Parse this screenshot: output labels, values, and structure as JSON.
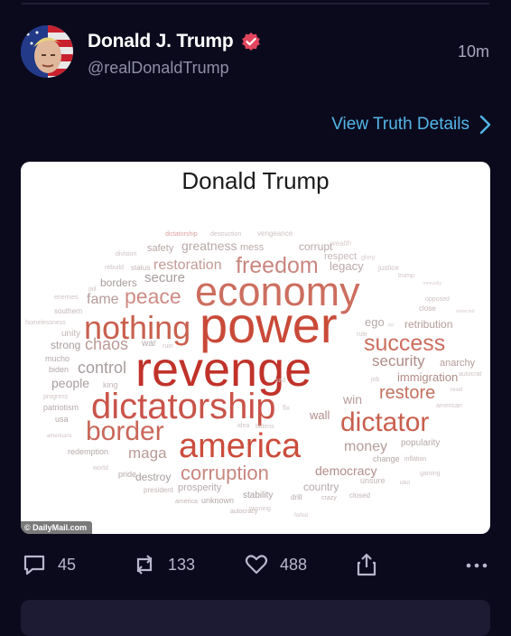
{
  "post": {
    "display_name": "Donald J. Trump",
    "handle": "@realDonaldTrump",
    "time": "10m",
    "view_details": "View Truth Details"
  },
  "image": {
    "title": "Donald Trump",
    "credit": "© DailyMail.com",
    "words": [
      {
        "t": "dictatorship",
        "c": "#d9a3a0"
      },
      {
        "t": "destruction",
        "c": "#cfc3c3"
      },
      {
        "t": "vengeance",
        "c": "#cfc3c3"
      },
      {
        "t": "division",
        "c": "#cfc3c3"
      },
      {
        "t": "safety",
        "c": "#b9a7a7"
      },
      {
        "t": "greatness",
        "c": "#b9a7a7"
      },
      {
        "t": "mess",
        "c": "#bcaaaa"
      },
      {
        "t": "corrupt",
        "c": "#b9a7a7"
      },
      {
        "t": "wealth",
        "c": "#d9cccc"
      },
      {
        "t": "respect",
        "c": "#c8b8b8"
      },
      {
        "t": "glory",
        "c": "#d9cccc"
      },
      {
        "t": "rebuild",
        "c": "#cfc3c3"
      },
      {
        "t": "status",
        "c": "#c4b4b4"
      },
      {
        "t": "restoration",
        "c": "#c49a96"
      },
      {
        "t": "freedom",
        "c": "#c9867f"
      },
      {
        "t": "legacy",
        "c": "#b9a7a7"
      },
      {
        "t": "justice",
        "c": "#cfc3c3"
      },
      {
        "t": "jail",
        "c": "#d0c3c3"
      },
      {
        "t": "borders",
        "c": "#a89d9d"
      },
      {
        "t": "secure",
        "c": "#a89d9d"
      },
      {
        "t": "trump",
        "c": "#d0c3c3"
      },
      {
        "t": "immunity",
        "c": "#d9cccc"
      },
      {
        "t": "enemies",
        "c": "#d0c3c3"
      },
      {
        "t": "fame",
        "c": "#b49c9a"
      },
      {
        "t": "peace",
        "c": "#cf8b84"
      },
      {
        "t": "economy",
        "c": "#cc6e5f"
      },
      {
        "t": "opposed",
        "c": "#d0c3c3"
      },
      {
        "t": "southern",
        "c": "#c4b4b4"
      },
      {
        "t": "close",
        "c": "#c4b4b4"
      },
      {
        "t": "reelected",
        "c": "#d9cccc"
      },
      {
        "t": "homelessness",
        "c": "#d0c3c3"
      },
      {
        "t": "nothing",
        "c": "#c95f4d"
      },
      {
        "t": "power",
        "c": "#c94a38"
      },
      {
        "t": "ego",
        "c": "#b5a9a9"
      },
      {
        "t": "tax",
        "c": "#d9cccc"
      },
      {
        "t": "retribution",
        "c": "#b49c9a"
      },
      {
        "t": "unity",
        "c": "#c4b4b4"
      },
      {
        "t": "rule",
        "c": "#d0c3c3"
      },
      {
        "t": "strong",
        "c": "#a89d9d"
      },
      {
        "t": "war",
        "c": "#b5a9a9"
      },
      {
        "t": "ruin",
        "c": "#d0c3c3"
      },
      {
        "t": "chaos",
        "c": "#b89a96"
      },
      {
        "t": "success",
        "c": "#cc6e5f"
      },
      {
        "t": "mucho",
        "c": "#b5a9a9"
      },
      {
        "t": "revenge",
        "c": "#c0322a"
      },
      {
        "t": "security",
        "c": "#b08c88"
      },
      {
        "t": "anarchy",
        "c": "#b49c9a"
      },
      {
        "t": "biden",
        "c": "#b5a9a9"
      },
      {
        "t": "control",
        "c": "#a89d9d"
      },
      {
        "t": "immigration",
        "c": "#b08c88"
      },
      {
        "t": "job",
        "c": "#d0c3c3"
      },
      {
        "t": "sad",
        "c": "#d0c3c3"
      },
      {
        "t": "autocrat",
        "c": "#d0c3c3"
      },
      {
        "t": "people",
        "c": "#a89d9d"
      },
      {
        "t": "king",
        "c": "#c4b4b4"
      },
      {
        "t": "restore",
        "c": "#c4705f"
      },
      {
        "t": "reset",
        "c": "#d0c3c3"
      },
      {
        "t": "progress",
        "c": "#d0c3c3"
      },
      {
        "t": "dictatorship",
        "c": "#c9544a"
      },
      {
        "t": "win",
        "c": "#b49c9a"
      },
      {
        "t": "patriotism",
        "c": "#b5a9a9"
      },
      {
        "t": "american",
        "c": "#d0c3c3"
      },
      {
        "t": "fix",
        "c": "#d0c3c3"
      },
      {
        "t": "wall",
        "c": "#b08c88"
      },
      {
        "t": "usa",
        "c": "#b5a9a9"
      },
      {
        "t": "dictator",
        "c": "#c95f4d"
      },
      {
        "t": "bidens",
        "c": "#d0c3c3"
      },
      {
        "t": "idea",
        "c": "#d0c3c3"
      },
      {
        "t": "border",
        "c": "#c9675a"
      },
      {
        "t": "americans",
        "c": "#d0c3c3"
      },
      {
        "t": "america",
        "c": "#cb4d3c"
      },
      {
        "t": "money",
        "c": "#b49c9a"
      },
      {
        "t": "popularity",
        "c": "#b5a9a9"
      },
      {
        "t": "redemption",
        "c": "#b5a9a9"
      },
      {
        "t": "maga",
        "c": "#b89a96"
      },
      {
        "t": "change",
        "c": "#b5a9a9"
      },
      {
        "t": "inflation",
        "c": "#c4b4b4"
      },
      {
        "t": "world",
        "c": "#d0c3c3"
      },
      {
        "t": "pride",
        "c": "#b5a9a9"
      },
      {
        "t": "destroy",
        "c": "#a89d9d"
      },
      {
        "t": "corruption",
        "c": "#c9867f"
      },
      {
        "t": "democracy",
        "c": "#b08c88"
      },
      {
        "t": "gaining",
        "c": "#d0c3c3"
      },
      {
        "t": "unsure",
        "c": "#c4b4b4"
      },
      {
        "t": "idiot",
        "c": "#d0c3c3"
      },
      {
        "t": "president",
        "c": "#c4b4b4"
      },
      {
        "t": "prosperity",
        "c": "#b5a9a9"
      },
      {
        "t": "country",
        "c": "#b5a9a9"
      },
      {
        "t": "stability",
        "c": "#a89d9d"
      },
      {
        "t": "drill",
        "c": "#b5a9a9"
      },
      {
        "t": "crazy",
        "c": "#c4b4b4"
      },
      {
        "t": "closed",
        "c": "#c4b4b4"
      },
      {
        "t": "america",
        "c": "#c4b4b4"
      },
      {
        "t": "unknown",
        "c": "#b5a9a9"
      },
      {
        "t": "winning",
        "c": "#d0c3c3"
      },
      {
        "t": "autocracy",
        "c": "#c4b4b4"
      },
      {
        "t": "forbid",
        "c": "#d0c3c3"
      }
    ]
  },
  "actions": {
    "replies": "45",
    "retruths": "133",
    "likes": "488"
  }
}
